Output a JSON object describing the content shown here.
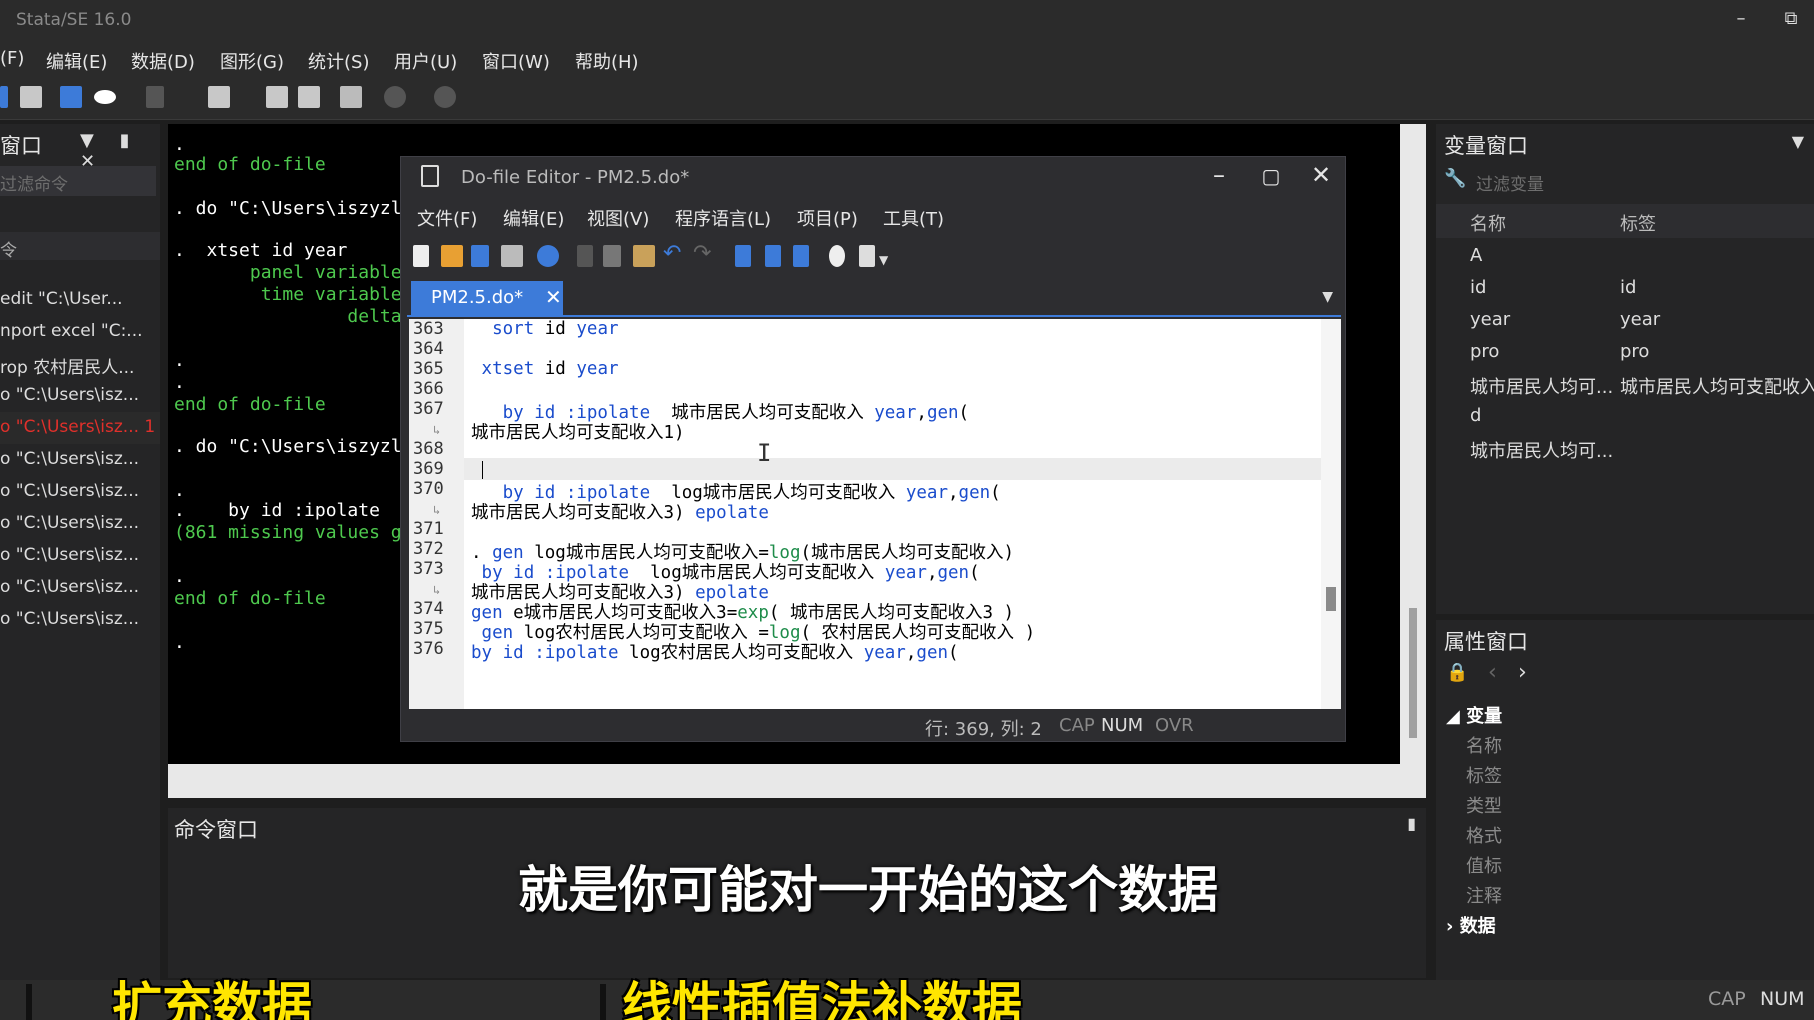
{
  "app": {
    "title": "Stata/SE 16.0",
    "minimize": "–",
    "restore": "⧉"
  },
  "menu": [
    "(F)",
    "编辑(E)",
    "数据(D)",
    "图形(G)",
    "统计(S)",
    "用户(U)",
    "窗口(W)",
    "帮助(H)"
  ],
  "history": {
    "title": "窗口",
    "filter_placeholder": "过滤命令",
    "column": "令",
    "items": [
      {
        "text": "edit \"C:\\User...",
        "error": false
      },
      {
        "text": "nport excel \"C:...",
        "error": false
      },
      {
        "text": "rop 农村居民人...",
        "error": false
      },
      {
        "text": "o \"C:\\Users\\isz...",
        "error": false
      },
      {
        "text": "o \"C:\\Users\\isz...  1",
        "error": true
      },
      {
        "text": "o \"C:\\Users\\isz...",
        "error": false
      },
      {
        "text": "o \"C:\\Users\\isz...",
        "error": false
      },
      {
        "text": "o \"C:\\Users\\isz...",
        "error": false
      },
      {
        "text": "o \"C:\\Users\\isz...",
        "error": false
      },
      {
        "text": "o \"C:\\Users\\isz...",
        "error": false
      },
      {
        "text": "o \"C:\\Users\\isz...",
        "error": false
      }
    ]
  },
  "results": {
    "lines": [
      {
        "t": ".",
        "c": "#ffffff"
      },
      {
        "t": "end of do-file",
        "c": "#4ec94e"
      },
      {
        "t": ". do \"C:\\Users\\iszyzl",
        "c": "#ffffff"
      },
      {
        "t": ".  xtset id year",
        "c": "#ffffff"
      },
      {
        "t": "       panel variable",
        "c": "#4ec94e"
      },
      {
        "t": "        time variable",
        "c": "#4ec94e"
      },
      {
        "t": "                delta",
        "c": "#4ec94e"
      },
      {
        "t": ".",
        "c": "#ffffff"
      },
      {
        "t": ".",
        "c": "#ffffff"
      },
      {
        "t": "end of do-file",
        "c": "#4ec94e"
      },
      {
        "t": ". do \"C:\\Users\\iszyzl",
        "c": "#ffffff"
      },
      {
        "t": ".",
        "c": "#ffffff"
      },
      {
        "t": ".    by id :ipolate",
        "c": "#ffffff"
      },
      {
        "t": "(861 missing values g",
        "c": "#4ec94e"
      },
      {
        "t": ".",
        "c": "#ffffff"
      },
      {
        "t": "end of do-file",
        "c": "#4ec94e"
      },
      {
        "t": ".",
        "c": "#ffffff"
      }
    ]
  },
  "command_window": {
    "title": "命令窗口"
  },
  "variables": {
    "title": "变量窗口",
    "filter_placeholder": "过滤变量",
    "col_name": "名称",
    "col_label": "标签",
    "rows": [
      {
        "name": "A",
        "label": ""
      },
      {
        "name": "id",
        "label": "id"
      },
      {
        "name": "year",
        "label": "year"
      },
      {
        "name": "pro",
        "label": "pro"
      },
      {
        "name": "城市居民人均可...",
        "label": "城市居民人均可支配收入"
      },
      {
        "name": "d",
        "label": ""
      },
      {
        "name": "城市居民人均可...",
        "label": ""
      }
    ]
  },
  "properties": {
    "title": "属性窗口",
    "group_variables": "变量",
    "fields": [
      "名称",
      "标签",
      "类型",
      "格式",
      "值标",
      "注释"
    ],
    "group_data": "数据"
  },
  "editor": {
    "title": "Do-file Editor - PM2.5.do*",
    "menu": [
      "文件(F)",
      "编辑(E)",
      "视图(V)",
      "程序语言(L)",
      "项目(P)",
      "工具(T)"
    ],
    "tab": "PM2.5.do*",
    "status": {
      "pos": "行: 369, 列: 2",
      "cap": "CAP",
      "num": "NUM",
      "ovr": "OVR"
    },
    "lines": [
      {
        "n": "363",
        "code": "  sort id year"
      },
      {
        "n": "364",
        "code": ""
      },
      {
        "n": "365",
        "code": " xtset id year"
      },
      {
        "n": "366",
        "code": ""
      },
      {
        "n": "367",
        "code": "   by id :ipolate  城市居民人均可支配收入 year,gen("
      },
      {
        "n": "",
        "code": "城市居民人均可支配收入1)"
      },
      {
        "n": "368",
        "code": ""
      },
      {
        "n": "369",
        "code": ""
      },
      {
        "n": "370",
        "code": "   by id :ipolate  log城市居民人均可支配收入 year,gen("
      },
      {
        "n": "",
        "code": "城市居民人均可支配收入3) epolate"
      },
      {
        "n": "371",
        "code": ""
      },
      {
        "n": "372",
        "code": ". gen log城市居民人均可支配收入=log(城市居民人均可支配收入)"
      },
      {
        "n": "373",
        "code": " by id :ipolate  log城市居民人均可支配收入 year,gen("
      },
      {
        "n": "",
        "code": "城市居民人均可支配收入3) epolate"
      },
      {
        "n": "374",
        "code": "gen e城市居民人均可支配收入3=exp( 城市居民人均可支配收入3 )"
      },
      {
        "n": "375",
        "code": " gen log农村居民人均可支配收入 =log( 农村居民人均可支配收入 )"
      },
      {
        "n": "376",
        "code": "by id :ipolate log农村居民人均可支配收入 year,gen("
      }
    ]
  },
  "status_bar": {
    "cap": "CAP",
    "num": "NUM"
  },
  "subtitles": {
    "main": "就是你可能对一开始的这个数据",
    "left": "扩充数据",
    "right": "线性插值法补数据"
  }
}
